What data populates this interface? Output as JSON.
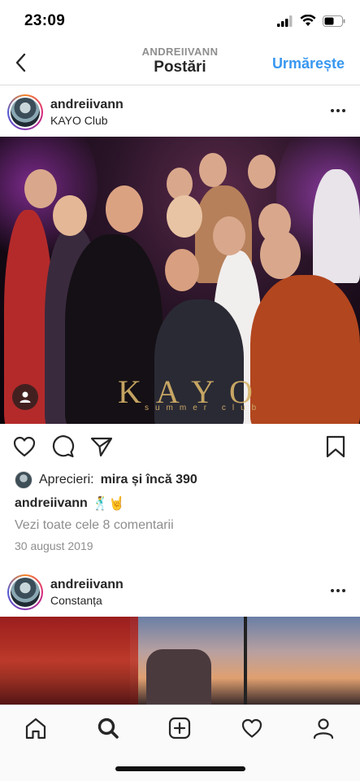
{
  "status_bar": {
    "time": "23:09"
  },
  "header": {
    "subtitle": "ANDREIIVANN",
    "title": "Postări",
    "follow_label": "Urmărește"
  },
  "posts": [
    {
      "username": "andreiivann",
      "location": "KAYO Club",
      "photo_text": "KAYO",
      "photo_subtext": "summer club",
      "likes_label": "Aprecieri:",
      "likes_text": "mira și încă 390",
      "caption_user": "andreiivann",
      "caption_emojis": "🕺🤘",
      "comments_link": "Vezi toate cele 8 comentarii",
      "date": "30 august 2019"
    },
    {
      "username": "andreiivann",
      "location": "Constanța"
    }
  ],
  "tabs": [
    "home-icon",
    "search-icon",
    "add-post-icon",
    "activity-heart-icon",
    "profile-icon"
  ],
  "colors": {
    "accent": "#3897f0",
    "text": "#262626",
    "muted": "#8e8e8e",
    "border": "#dbdbdb"
  }
}
